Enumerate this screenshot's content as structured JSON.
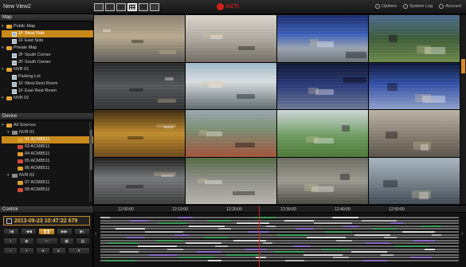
{
  "app": {
    "title": "New View2",
    "brand": "ACTi",
    "brand_color": "#d2201e",
    "accent_color": "#c98a1c"
  },
  "top_actions": [
    {
      "label": "Options",
      "icon": "gear-icon"
    },
    {
      "label": "System Log",
      "icon": "log-icon"
    },
    {
      "label": "Account",
      "icon": "user-icon"
    }
  ],
  "map_panel": {
    "title": "Map",
    "items": [
      {
        "label": "Public Map",
        "type": "folder",
        "level": 0
      },
      {
        "label": "1F West Side",
        "type": "map",
        "level": 1,
        "selected": true
      },
      {
        "label": "1F East Side",
        "type": "map",
        "level": 1
      },
      {
        "label": "Private Map",
        "type": "folder",
        "level": 0
      },
      {
        "label": "2F South Corner",
        "type": "map",
        "level": 1
      },
      {
        "label": "2F South Corner",
        "type": "map",
        "level": 1
      },
      {
        "label": "NVR 01",
        "type": "folder",
        "level": 0
      },
      {
        "label": "Parking Lot",
        "type": "map",
        "level": 1
      },
      {
        "label": "1F West Rest Room",
        "type": "map",
        "level": 1
      },
      {
        "label": "1F East Rest Room",
        "type": "map",
        "level": 1
      },
      {
        "label": "NVR 02",
        "type": "folder",
        "level": 0
      }
    ]
  },
  "device_panel": {
    "title": "Device",
    "items": [
      {
        "label": "All Sources",
        "type": "folder",
        "level": 0
      },
      {
        "label": "NVR 01",
        "type": "nvr",
        "level": 1
      },
      {
        "label": "01 ACM8511",
        "type": "cam",
        "level": 2,
        "selected": true
      },
      {
        "label": "03 ACM8511",
        "type": "cam",
        "level": 2
      },
      {
        "label": "04 ACM8511",
        "type": "cam",
        "level": 2
      },
      {
        "label": "05 ACM8511",
        "type": "cam",
        "level": 2
      },
      {
        "label": "06 ACM8511",
        "type": "cam",
        "level": 2
      },
      {
        "label": "NVR 02",
        "type": "nvr",
        "level": 1
      },
      {
        "label": "07 ACM8511",
        "type": "cam",
        "level": 2
      },
      {
        "label": "08 ACM8511",
        "type": "cam",
        "level": 2
      }
    ]
  },
  "control_panel": {
    "title": "Control",
    "datetime": "2013-09-23 10:47:22 679"
  },
  "timeline": {
    "ticks": [
      "12:00:00",
      "12:10:00",
      "12:20:00",
      "12:30:00",
      "12:40:00",
      "12:50:00"
    ]
  }
}
